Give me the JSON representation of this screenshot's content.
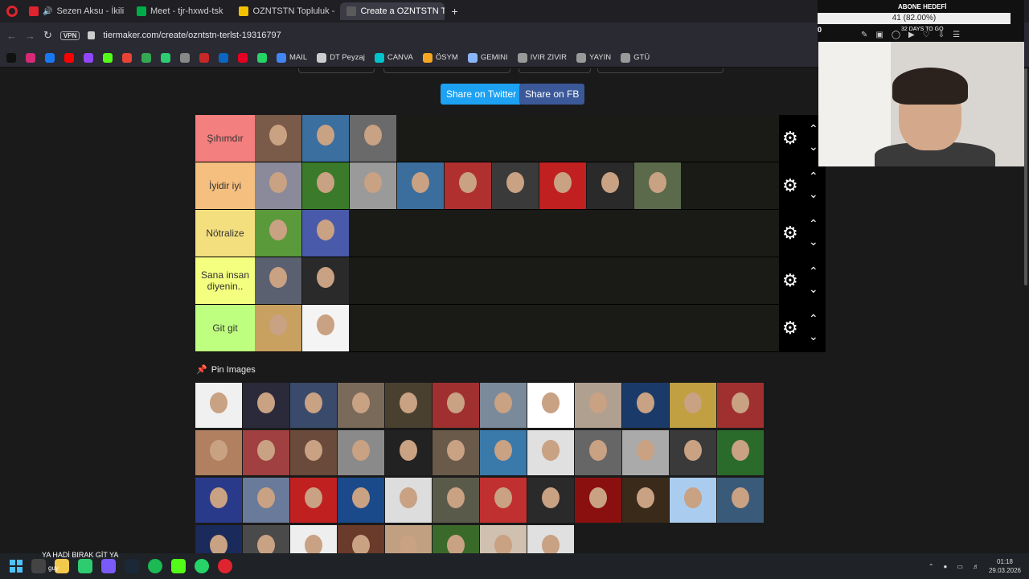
{
  "tabs": [
    {
      "label": "Sezen Aksu - İkili Deli",
      "color": "#e0242f",
      "active": false
    },
    {
      "label": "Meet - tjr-hxwd-tsk",
      "color": "#00ac47",
      "active": false
    },
    {
      "label": "OZNTSTN Topluluk - Tier L",
      "color": "#f2c200",
      "active": false
    },
    {
      "label": "Create a OZNTSTN TİERLİS",
      "color": "#5a5a5a",
      "active": true
    }
  ],
  "address": {
    "vpn": "VPN",
    "url": "tiermaker.com/create/ozntstn-terlst-19316797"
  },
  "bookmarks": [
    {
      "label": "",
      "color": "#111"
    },
    {
      "label": "",
      "color": "#d62976"
    },
    {
      "label": "",
      "color": "#1877f2"
    },
    {
      "label": "",
      "color": "#ff0000"
    },
    {
      "label": "",
      "color": "#9146ff"
    },
    {
      "label": "",
      "color": "#53fc18"
    },
    {
      "label": "",
      "color": "#ea4335"
    },
    {
      "label": "",
      "color": "#34a853"
    },
    {
      "label": "",
      "color": "#2ecc71"
    },
    {
      "label": "",
      "color": "#888"
    },
    {
      "label": "",
      "color": "#c62828"
    },
    {
      "label": "",
      "color": "#0a66c2"
    },
    {
      "label": "",
      "color": "#e60023"
    },
    {
      "label": "",
      "color": "#25d366"
    },
    {
      "label": "MAIL",
      "color": "#4285f4"
    },
    {
      "label": "DT Peyzaj",
      "color": "#ccc"
    },
    {
      "label": "CANVA",
      "color": "#00c4cc"
    },
    {
      "label": "ÖSYM",
      "color": "#f5a623"
    },
    {
      "label": "GEMINI",
      "color": "#8ab4f8"
    },
    {
      "label": "IVIR ZIVIR",
      "color": "#999"
    },
    {
      "label": "YAYIN",
      "color": "#999"
    },
    {
      "label": "GTÜ",
      "color": "#999"
    }
  ],
  "share": {
    "twitter": "Share on Twitter",
    "fb": "Share on FB"
  },
  "tiers": [
    {
      "label": "Şıhımdır",
      "color": "#f47f7f",
      "items": [
        "#7a5a48",
        "#3a6fa0",
        "#6a6a6a"
      ]
    },
    {
      "label": "İyidir iyi",
      "color": "#f4bf7f",
      "items": [
        "#8a8a9a",
        "#3a7a2a",
        "#9a9a9a",
        "#3b6e9c",
        "#b03030",
        "#3a3a3a",
        "#c02020",
        "#2a2a2a",
        "#5a6a4a"
      ]
    },
    {
      "label": "Nötralize",
      "color": "#f4df7f",
      "items": [
        "#5a9a3a",
        "#4a5aaa"
      ]
    },
    {
      "label": "Sana insan diyenin..",
      "color": "#f4ff7f",
      "items": [
        "#5a6070",
        "#2a2a2a"
      ]
    },
    {
      "label": "Git git",
      "color": "#bfff7f",
      "items": [
        "#c8a060",
        "#f4f4f4"
      ]
    }
  ],
  "pin_images": {
    "label": "Pin Images",
    "items": [
      "#f0f0f0",
      "#2a2a3a",
      "#3a4a6a",
      "#7a6a5a",
      "#4a4030",
      "#a03030",
      "#7a8a9a",
      "#ffffff",
      "#b0a090",
      "#1a3a6a",
      "#c0a040",
      "#a03030",
      "#b08060",
      "#a04040",
      "#6a4a3a",
      "#8a8a8a",
      "#222222",
      "#6a5a4a",
      "#3a7aaa",
      "#e0e0e0",
      "#666666",
      "#aaaaaa",
      "#3a3a3a",
      "#2a6a2a",
      "#2a3a8a",
      "#6a7a9a",
      "#c02020",
      "#1a4a8a",
      "#dddddd",
      "#5a5a4a",
      "#c03030",
      "#2a2a2a",
      "#8a1010",
      "#3a2a1a",
      "#aaccee",
      "#3a5a7a",
      "#1a2a5a",
      "#4a4a4a",
      "#eeeeee",
      "#6a3a2a",
      "#c0a080",
      "#3a6a2a",
      "#d0c0b0",
      "#e0e0e0"
    ]
  },
  "taskbar": {
    "time": "01:18",
    "date": "29.03.2026"
  },
  "stream_overlay": {
    "goal_title": "ABONE HEDEFİ",
    "goal_progress": "41 (82.00%)",
    "zero": "0",
    "days": "32 DAYS TO GO"
  },
  "ticker": {
    "line1": "YA HADİ BIRAK GİT YA",
    "line2": "guy"
  }
}
